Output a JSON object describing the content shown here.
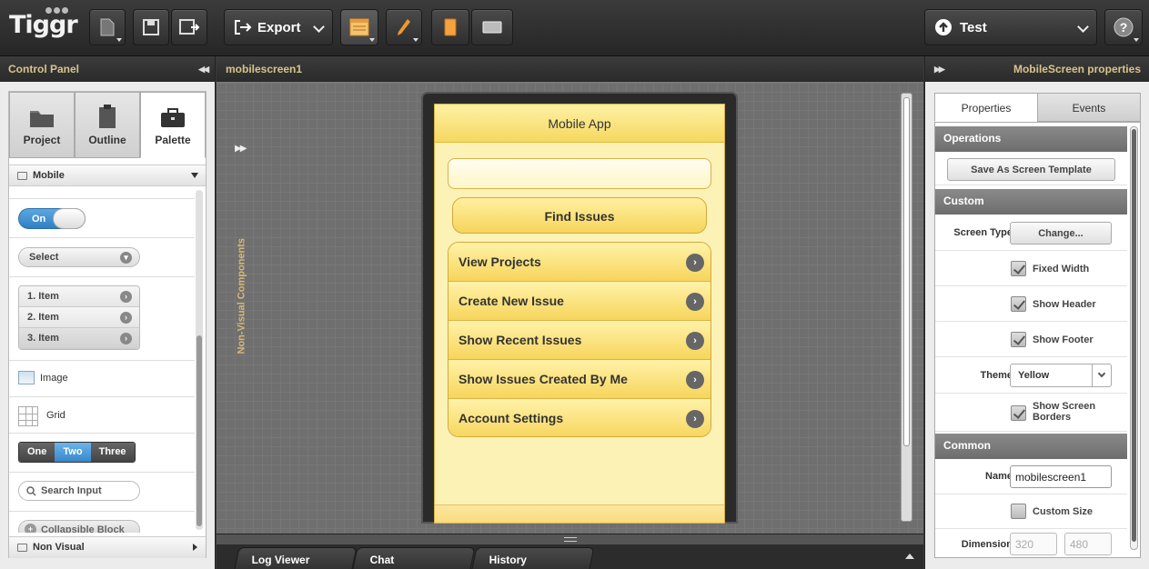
{
  "app": {
    "logo": "Tiggr"
  },
  "toolbar": {
    "export_label": "Export",
    "test_label": "Test"
  },
  "left_panel": {
    "title": "Control Panel",
    "tabs": [
      {
        "label": "Project",
        "icon": "folder-icon"
      },
      {
        "label": "Outline",
        "icon": "clipboard-icon"
      },
      {
        "label": "Palette",
        "icon": "briefcase-icon"
      }
    ],
    "active_tab": "Palette",
    "category": "Mobile",
    "palette": {
      "toggle_label": "On",
      "select_label": "Select",
      "list_items": [
        "1. Item",
        "2. Item",
        "3. Item"
      ],
      "image_label": "Image",
      "grid_label": "Grid",
      "segments": [
        "One",
        "Two",
        "Three"
      ],
      "active_segment": "Two",
      "search_label": "Search Input",
      "collapsible_label": "Collapsible Block"
    },
    "footer_category": "Non Visual"
  },
  "editor": {
    "title": "mobilescreen1",
    "non_visual_label": "Non-Visual Components",
    "mobile": {
      "header": "Mobile App",
      "input_value": "",
      "button_label": "Find Issues",
      "list_items": [
        "View Projects",
        "Create New Issue",
        "Show Recent Issues",
        "Show Issues Created By Me",
        "Account Settings"
      ]
    },
    "bottom_tabs": [
      "Log Viewer",
      "Chat",
      "History"
    ]
  },
  "right_panel": {
    "title": "MobileScreen properties",
    "tabs": [
      "Properties",
      "Events"
    ],
    "active_tab": "Properties",
    "sections": {
      "operations": "Operations",
      "custom": "Custom",
      "common": "Common"
    },
    "save_template_label": "Save As Screen Template",
    "screen_type_label": "Screen Type",
    "change_label": "Change...",
    "fixed_width_label": "Fixed Width",
    "fixed_width": true,
    "show_header_label": "Show Header",
    "show_header": true,
    "show_footer_label": "Show Footer",
    "show_footer": true,
    "theme_label": "Theme",
    "theme_value": "Yellow",
    "show_borders_label": "Show Screen Borders",
    "show_borders": true,
    "name_label": "Name",
    "name_value": "mobilescreen1",
    "custom_size_label": "Custom Size",
    "custom_size": false,
    "dimension_label": "Dimension",
    "width_placeholder": "320",
    "height_placeholder": "480"
  },
  "colors": {
    "accent_gold": "#d9c38a",
    "mobile_yellow": "#f7d55c",
    "segment_active": "#3688cc",
    "toolbar_bg": "#2e2e2e"
  }
}
